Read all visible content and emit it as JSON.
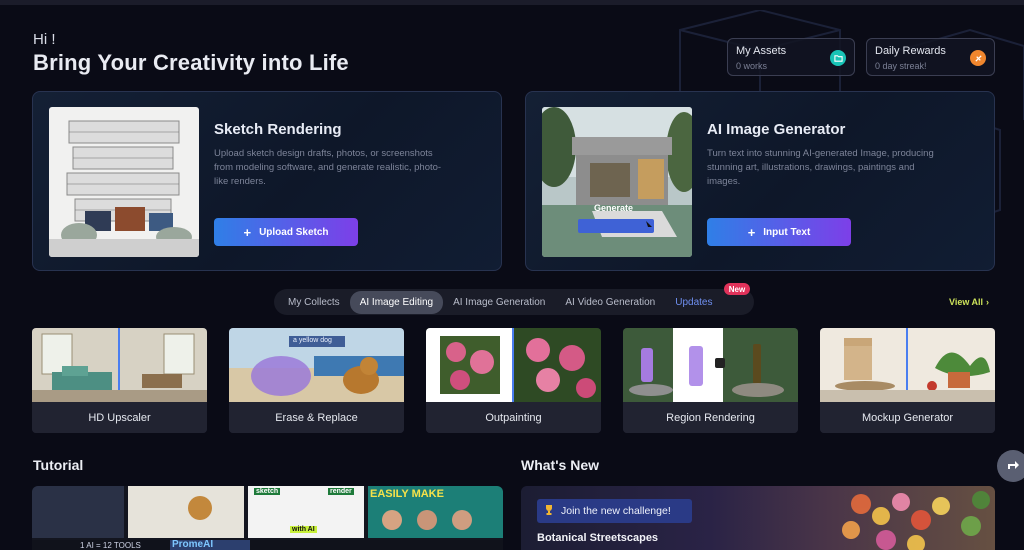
{
  "header": {
    "greeting": "Hi !",
    "headline": "Bring Your Creativity into Life"
  },
  "stats": {
    "assets": {
      "title": "My Assets",
      "sub": "0 works",
      "icon": "folder-icon"
    },
    "rewards": {
      "title": "Daily Rewards",
      "sub": "0 day streak!",
      "icon": "gift-icon"
    }
  },
  "features": {
    "sketch": {
      "title": "Sketch Rendering",
      "desc": "Upload sketch design drafts, photos, or screenshots from modeling software, and generate realistic, photo-like renders.",
      "button": "Upload Sketch"
    },
    "aigen": {
      "title": "AI Image Generator",
      "desc": "Turn text into stunning AI-generated Image, producing stunning art, illustrations, drawings, paintings and images.",
      "button": "Input Text",
      "thumb_label": "Generate"
    }
  },
  "tabs": [
    {
      "label": "My Collects",
      "active": false
    },
    {
      "label": "AI Image Editing",
      "active": true
    },
    {
      "label": "AI Image Generation",
      "active": false
    },
    {
      "label": "AI Video Generation",
      "active": false
    },
    {
      "label": "Updates",
      "active": false
    }
  ],
  "badge_new": "New",
  "view_all": "View All",
  "tools": [
    {
      "label": "HD Upscaler"
    },
    {
      "label": "Erase & Replace",
      "overlay": "a yellow dog"
    },
    {
      "label": "Outpainting"
    },
    {
      "label": "Region Rendering"
    },
    {
      "label": "Mockup Generator"
    }
  ],
  "tutorial": {
    "title": "Tutorial",
    "thumbs": [
      "sketch",
      "render",
      "with AI",
      "EASILY MAKE",
      "1 AI = 12 TOOLS",
      "PromeAI"
    ]
  },
  "whats_new": {
    "title": "What's New",
    "challenge": "Join the new challenge!",
    "subtitle": "Botanical Streetscapes"
  },
  "colors": {
    "accent_gradient_start": "#2f7fe7",
    "accent_gradient_end": "#7d3fe8",
    "view_all": "#cde35a",
    "badge": "#e0325a",
    "assets_icon": "#18c3b6",
    "rewards_icon": "#f0862e"
  }
}
